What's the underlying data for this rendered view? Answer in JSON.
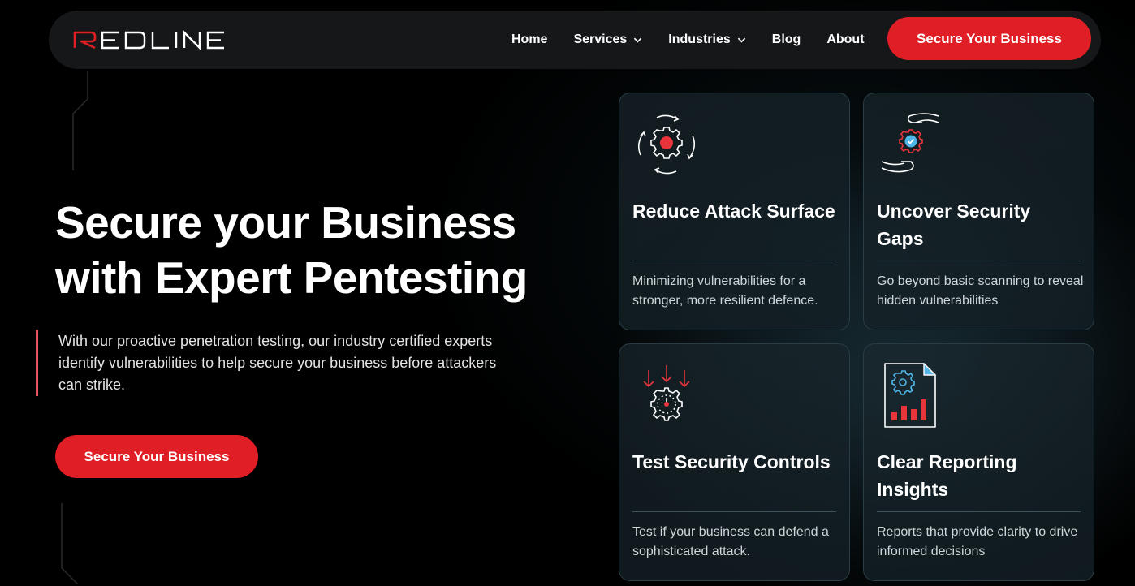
{
  "brand": {
    "logo_text": "REDLINE",
    "accent": "#e01e25"
  },
  "nav": {
    "links": [
      {
        "label": "Home"
      },
      {
        "label": "Services",
        "dropdown": true
      },
      {
        "label": "Industries",
        "dropdown": true
      },
      {
        "label": "Blog"
      },
      {
        "label": "About"
      }
    ],
    "cta_label": "Secure Your Business"
  },
  "hero": {
    "title_line1": "Secure your Business",
    "title_line2": "with Expert Pentesting",
    "description": "With our proactive penetration testing, our industry certified experts identify vulnerabilities to help secure your business before attackers can strike.",
    "cta_label": "Secure Your Business"
  },
  "cards": [
    {
      "icon": "gear-cycle-icon",
      "title": "Reduce Attack Surface",
      "text": "Minimizing vulnerabilities for a stronger, more resilient defence."
    },
    {
      "icon": "hands-gear-check-icon",
      "title": "Uncover Security Gaps",
      "text": "Go beyond basic scanning to reveal hidden vulnerabilities"
    },
    {
      "icon": "gear-arrows-target-icon",
      "title": "Test Security Controls",
      "text": "Test if your business can defend a sophisticated attack."
    },
    {
      "icon": "report-chart-icon",
      "title": "Clear Reporting Insights",
      "text": "Reports that provide clarity to drive informed decisions"
    }
  ]
}
